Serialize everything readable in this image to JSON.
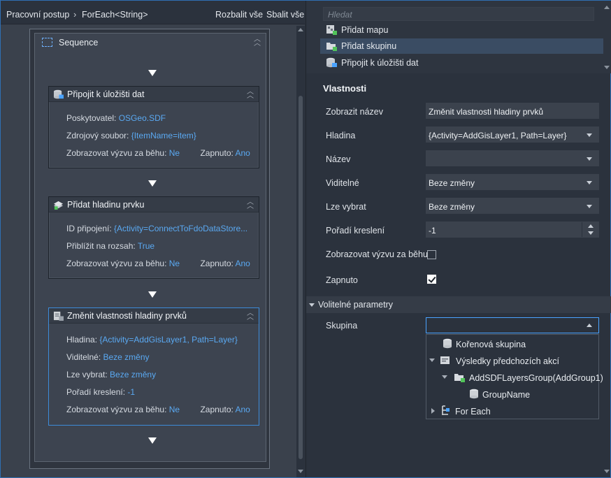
{
  "breadcrumb": {
    "root": "Pracovní postup",
    "current": "ForEach<String>",
    "expand_all": "Rozbalit vše",
    "collapse_all": "Sbalit vše"
  },
  "sequence": {
    "title": "Sequence",
    "activities": [
      {
        "title": "Připojit k úložišti dat",
        "icon": "database-connect-icon",
        "props": [
          {
            "label": "Poskytovatel:",
            "value": "OSGeo.SDF"
          },
          {
            "label": "Zdrojový soubor:",
            "value": "{ItemName=item}"
          }
        ],
        "footer": {
          "runtime_label": "Zobrazovat výzvu za běhu:",
          "runtime_value": "Ne",
          "enabled_label": "Zapnuto:",
          "enabled_value": "Ano"
        }
      },
      {
        "title": "Přidat hladinu prvku",
        "icon": "add-layer-icon",
        "props": [
          {
            "label": "ID připojení:",
            "value": "{Activity=ConnectToFdoDataStore..."
          },
          {
            "label": "Přiblížit na rozsah:",
            "value": "True"
          }
        ],
        "footer": {
          "runtime_label": "Zobrazovat výzvu za běhu:",
          "runtime_value": "Ne",
          "enabled_label": "Zapnuto:",
          "enabled_value": "Ano"
        }
      },
      {
        "title": "Změnit vlastnosti hladiny prvků",
        "icon": "layer-properties-icon",
        "props": [
          {
            "label": "Hladina:",
            "value": "{Activity=AddGisLayer1, Path=Layer}"
          },
          {
            "label": "Viditelné:",
            "value": "Beze změny"
          },
          {
            "label": "Lze vybrat:",
            "value": "Beze změny"
          },
          {
            "label": "Pořadí kreslení:",
            "value": "-1"
          }
        ],
        "footer": {
          "runtime_label": "Zobrazovat výzvu za běhu:",
          "runtime_value": "Ne",
          "enabled_label": "Zapnuto:",
          "enabled_value": "Ano"
        }
      }
    ]
  },
  "toolbox": {
    "search_placeholder": "Hledat",
    "items": [
      {
        "label": "Přidat mapu",
        "icon": "add-map-icon",
        "selected": false
      },
      {
        "label": "Přidat skupinu",
        "icon": "add-group-icon",
        "selected": true
      },
      {
        "label": "Připojit k úložišti dat",
        "icon": "database-connect-icon",
        "selected": false
      }
    ]
  },
  "properties": {
    "title": "Vlastnosti",
    "display_name_label": "Zobrazit název",
    "display_name_value": "Změnit vlastnosti hladiny prvků",
    "layer_label": "Hladina",
    "layer_value": "{Activity=AddGisLayer1, Path=Layer}",
    "name_label": "Název",
    "name_value": "",
    "visible_label": "Viditelné",
    "visible_value": "Beze změny",
    "selectable_label": "Lze vybrat",
    "selectable_value": "Beze změny",
    "draw_order_label": "Pořadí kreslení",
    "draw_order_value": "-1",
    "runtime_prompt_label": "Zobrazovat výzvu za běhu",
    "runtime_prompt_checked": false,
    "enabled_label": "Zapnuto",
    "enabled_checked": true
  },
  "optional": {
    "section_title": "Volitelné parametry",
    "group_label": "Skupina",
    "group_value": "",
    "tree": [
      {
        "label": "Kořenová skupina",
        "icon": "database-icon",
        "level": 0,
        "expander": "none"
      },
      {
        "label": "Výsledky předchozích akcí",
        "icon": "previous-results-icon",
        "level": 0,
        "expander": "open"
      },
      {
        "label": "AddSDFLayersGroup(AddGroup1)",
        "icon": "folder-add-icon",
        "level": 1,
        "expander": "open"
      },
      {
        "label": "GroupName",
        "icon": "database-icon",
        "level": 2,
        "expander": "none"
      },
      {
        "label": "For Each",
        "icon": "for-each-icon",
        "level": 0,
        "expander": "closed"
      }
    ]
  },
  "colors": {
    "accent": "#4aa3ff",
    "link_value": "#5aa9f2",
    "selection": "#3a4c63"
  }
}
